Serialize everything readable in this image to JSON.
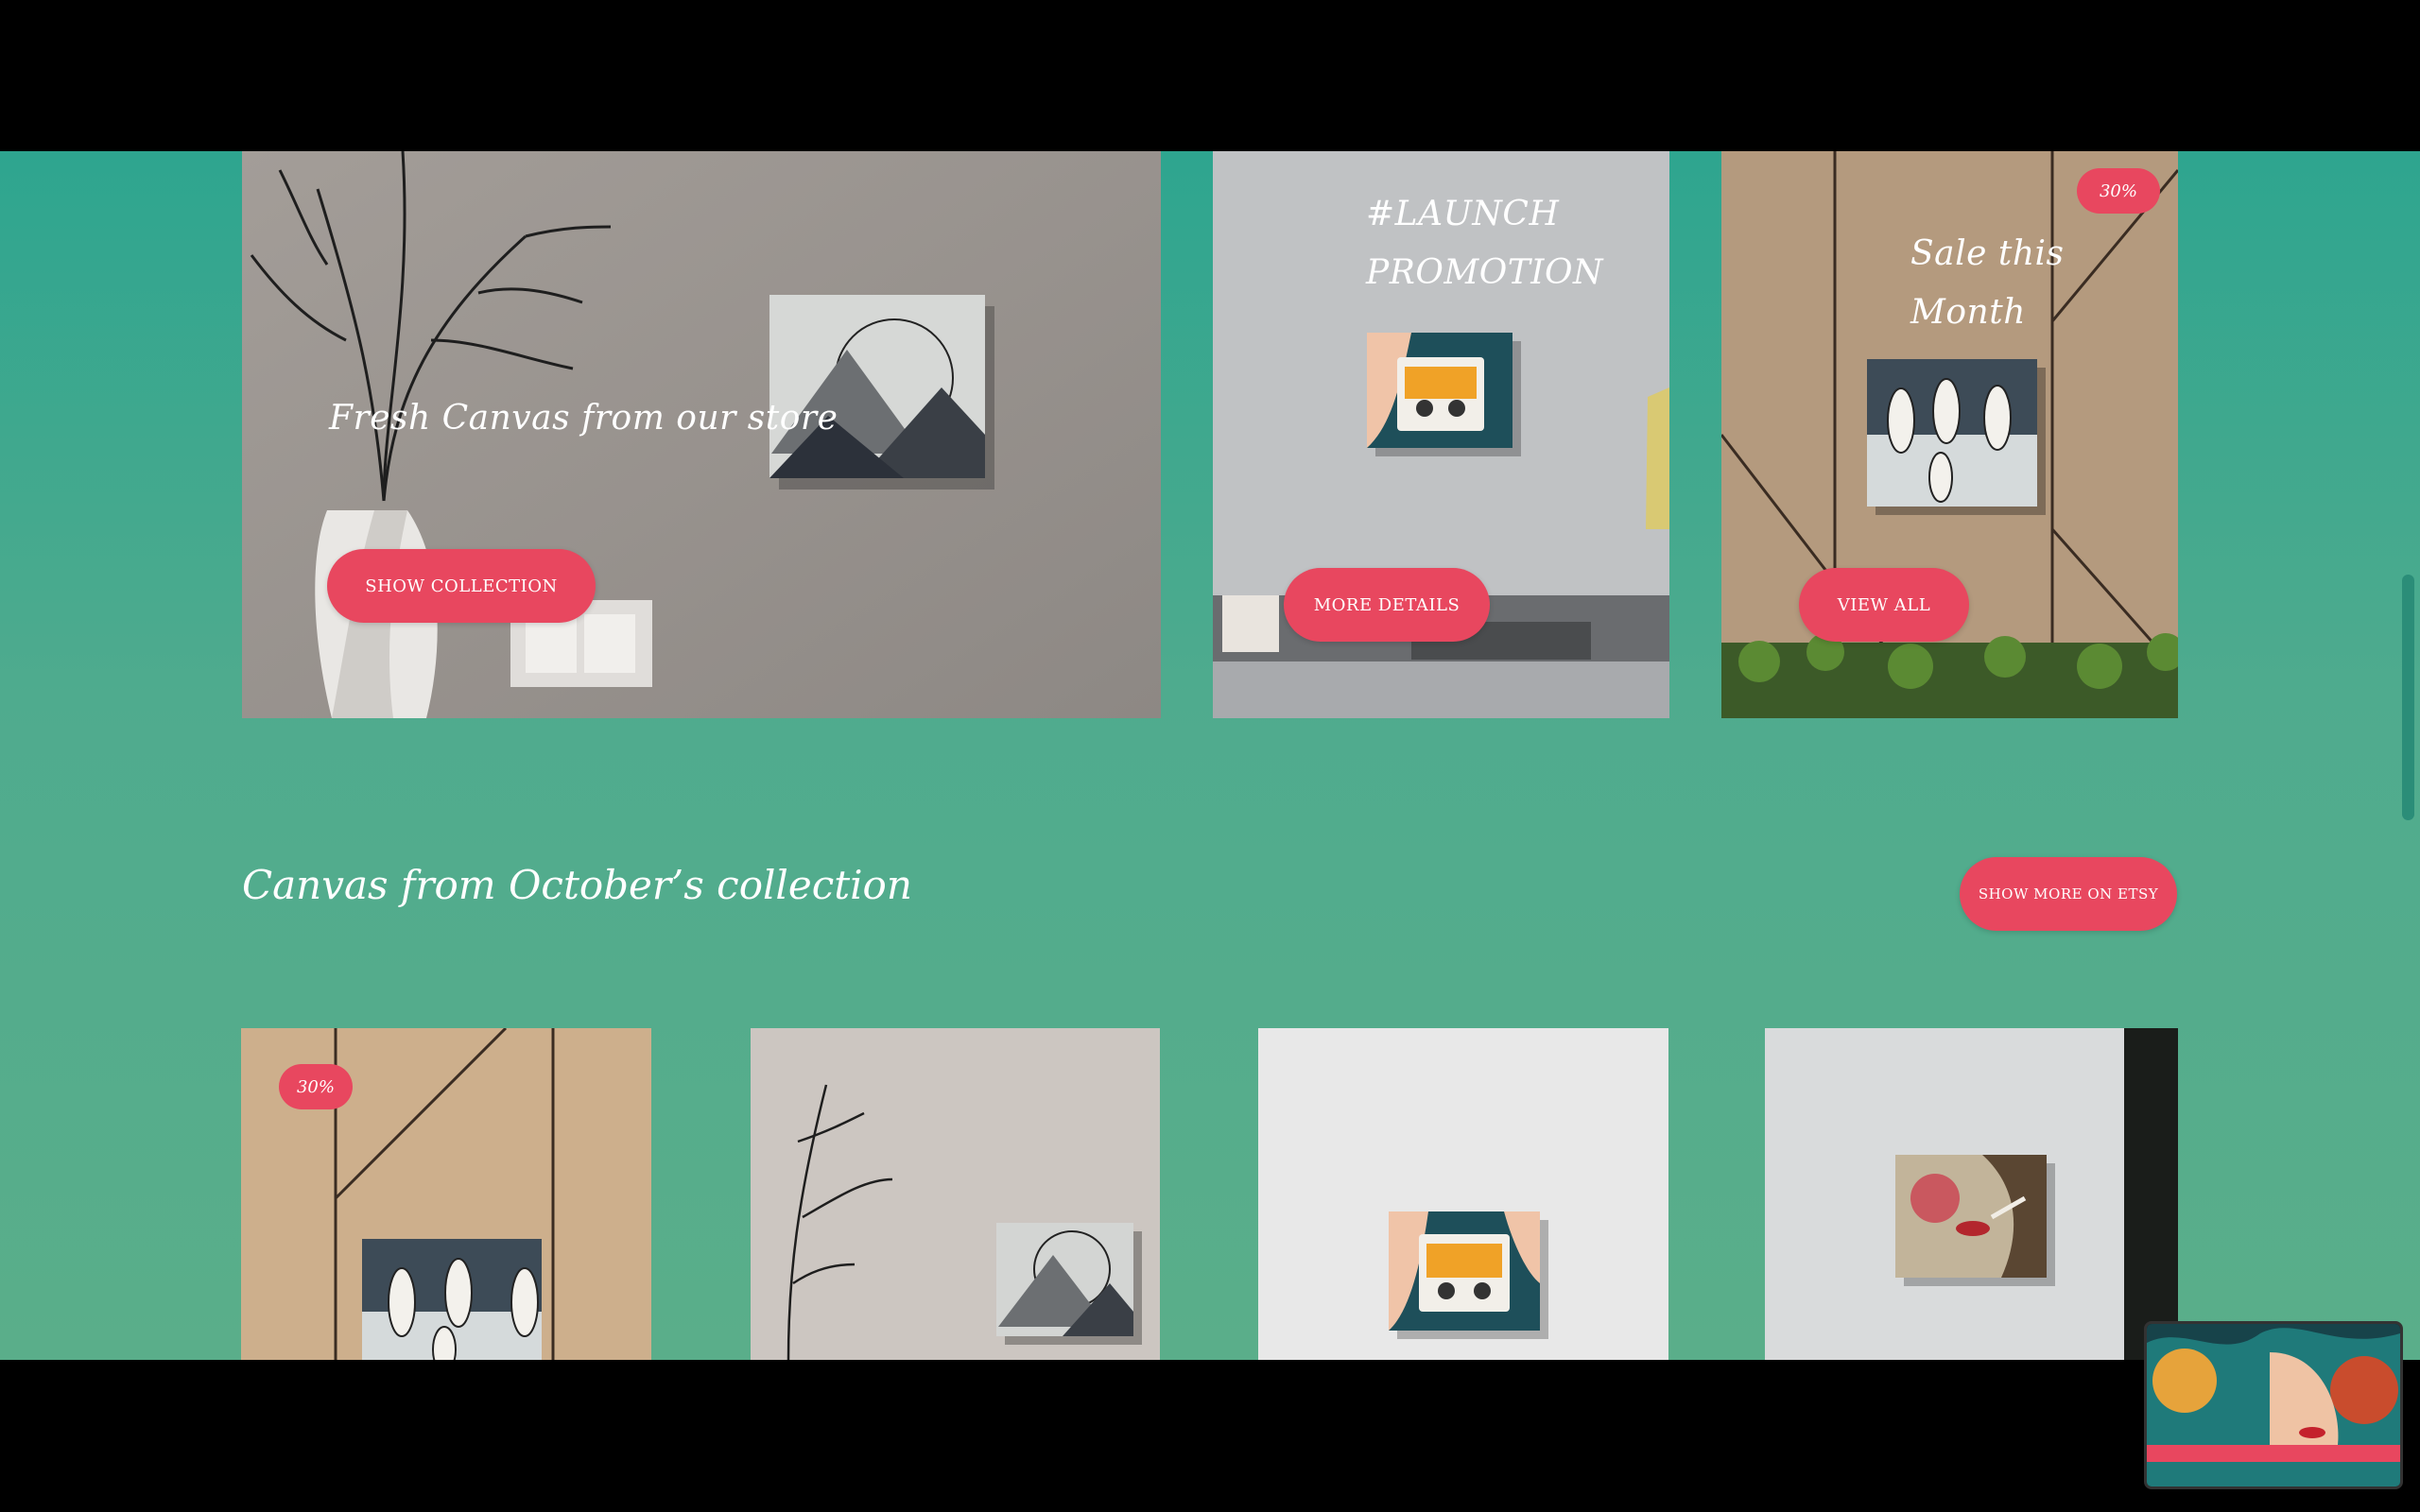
{
  "hero": {
    "main_card": {
      "title": "Fresh Canvas from our store",
      "button": "SHOW COLLECTION"
    },
    "launch_card": {
      "title_line1": "#LAUNCH",
      "title_line2": "PROMOTION",
      "button": "MORE DETAILS"
    },
    "sale_card": {
      "badge": "30%",
      "title_line1": "Sale this",
      "title_line2": "Month",
      "button": "VIEW ALL"
    }
  },
  "october_section": {
    "title": "Canvas from October’s collection",
    "button": "SHOW MORE ON ETSY"
  },
  "products": [
    {
      "badge": "30%",
      "art": "penguins-canvas"
    },
    {
      "art": "mountains-canvas"
    },
    {
      "art": "cassette-canvas"
    },
    {
      "art": "woman-portrait-canvas"
    }
  ],
  "colors": {
    "accent": "#e8475f",
    "background_top": "#2ea58f",
    "background_bottom": "#5aae8a"
  }
}
